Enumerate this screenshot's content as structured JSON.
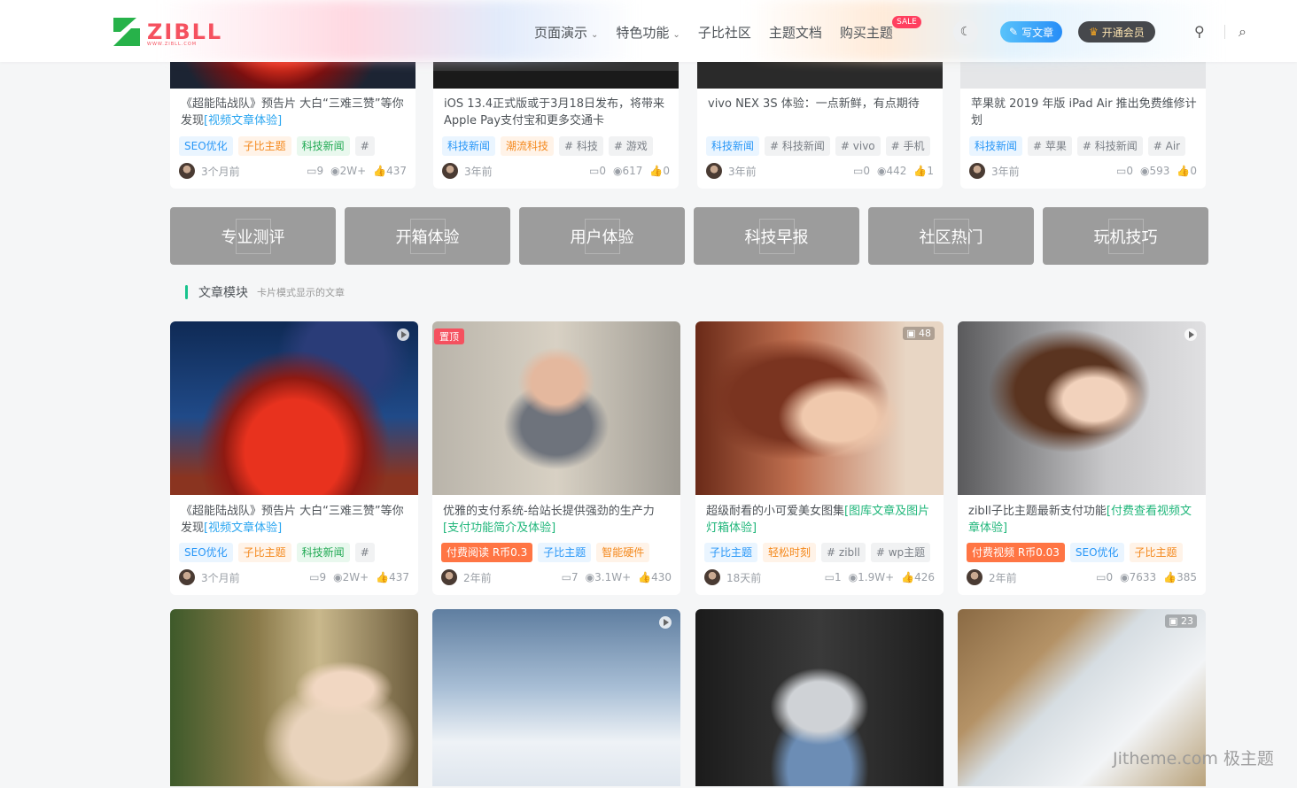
{
  "header": {
    "logo_text": "ZIBLL",
    "logo_sub": "WWW.ZIBLL.COM",
    "nav": [
      "页面演示",
      "特色功能",
      "子比社区",
      "主题文档",
      "购买主题"
    ],
    "nav_caret": "⌄",
    "sale_badge": "SALE",
    "moon_icon": "☾",
    "write_button": "写文章",
    "vip_button": "开通会员",
    "bulb_icon": "⚲",
    "search_icon": "⌕"
  },
  "top_cards": [
    {
      "title": "《超能陆战队》预告片 大白“三难三赞”等你发现",
      "title_link": "[视频文章体验]",
      "tags": [
        "SEO优化",
        "子比主题",
        "科技新闻",
        "#"
      ],
      "time": "3个月前",
      "comments": "9",
      "views": "2W+",
      "likes": "437"
    },
    {
      "title": "iOS 13.4正式版或于3月18日发布，将带来Apple Pay支付宝和更多交通卡",
      "title_link": "",
      "tags": [
        "科技新闻",
        "潮流科技",
        "# 科技",
        "# 游戏"
      ],
      "time": "3年前",
      "comments": "0",
      "views": "617",
      "likes": "0"
    },
    {
      "title": "vivo NEX 3S 体验：一点新鲜，有点期待",
      "title_link": "",
      "tags": [
        "科技新闻",
        "# 科技新闻",
        "# vivo",
        "# 手机"
      ],
      "time": "3年前",
      "comments": "0",
      "views": "442",
      "likes": "1"
    },
    {
      "title": "苹果就 2019 年版 iPad Air 推出免费维修计划",
      "title_link": "",
      "tags": [
        "科技新闻",
        "# 苹果",
        "# 科技新闻",
        "# Air"
      ],
      "time": "3年前",
      "comments": "0",
      "views": "593",
      "likes": "0"
    }
  ],
  "tiles": [
    "专业测评",
    "开箱体验",
    "用户体验",
    "科技早报",
    "社区热门",
    "玩机技巧"
  ],
  "section": {
    "title": "文章模块",
    "subtitle": "卡片模式显示的文章"
  },
  "cards": [
    {
      "title": "《超能陆战队》预告片 大白“三难三赞”等你发现",
      "title_link": "[视频文章体验]",
      "tags": [
        "SEO优化",
        "子比主题",
        "科技新闻",
        "#"
      ],
      "time": "3个月前",
      "comments": "9",
      "views": "2W+",
      "likes": "437",
      "badge": ""
    },
    {
      "title": "优雅的支付系统-给站长提供强劲的生产力",
      "title_link": "[支付功能简介及体验]",
      "tags": [
        "付费阅读 R币0.3",
        "子比主题",
        "智能硬件"
      ],
      "time": "2年前",
      "comments": "7",
      "views": "3.1W+",
      "likes": "430",
      "badge": "置顶"
    },
    {
      "title": "超级耐看的小可爱美女图集",
      "title_link": "[图库文章及图片灯箱体验]",
      "tags": [
        "子比主题",
        "轻松时刻",
        "# zibll",
        "# wp主题"
      ],
      "time": "18天前",
      "comments": "1",
      "views": "1.9W+",
      "likes": "426",
      "img_count": "48"
    },
    {
      "title": "zibll子比主题最新支付功能",
      "title_link": "[付费查看视频文章体验]",
      "tags": [
        "付费视频 R币0.03",
        "SEO优化",
        "子比主题"
      ],
      "time": "2年前",
      "comments": "0",
      "views": "7633",
      "likes": "385"
    }
  ],
  "bottom_cards": [
    {
      "img_count": ""
    },
    {
      "img_count": ""
    },
    {
      "img_count": ""
    },
    {
      "img_count": "23"
    }
  ],
  "icons": {
    "comment": "▭",
    "view": "◉",
    "like": "👍"
  },
  "watermark": "Jitheme.com 极主题"
}
